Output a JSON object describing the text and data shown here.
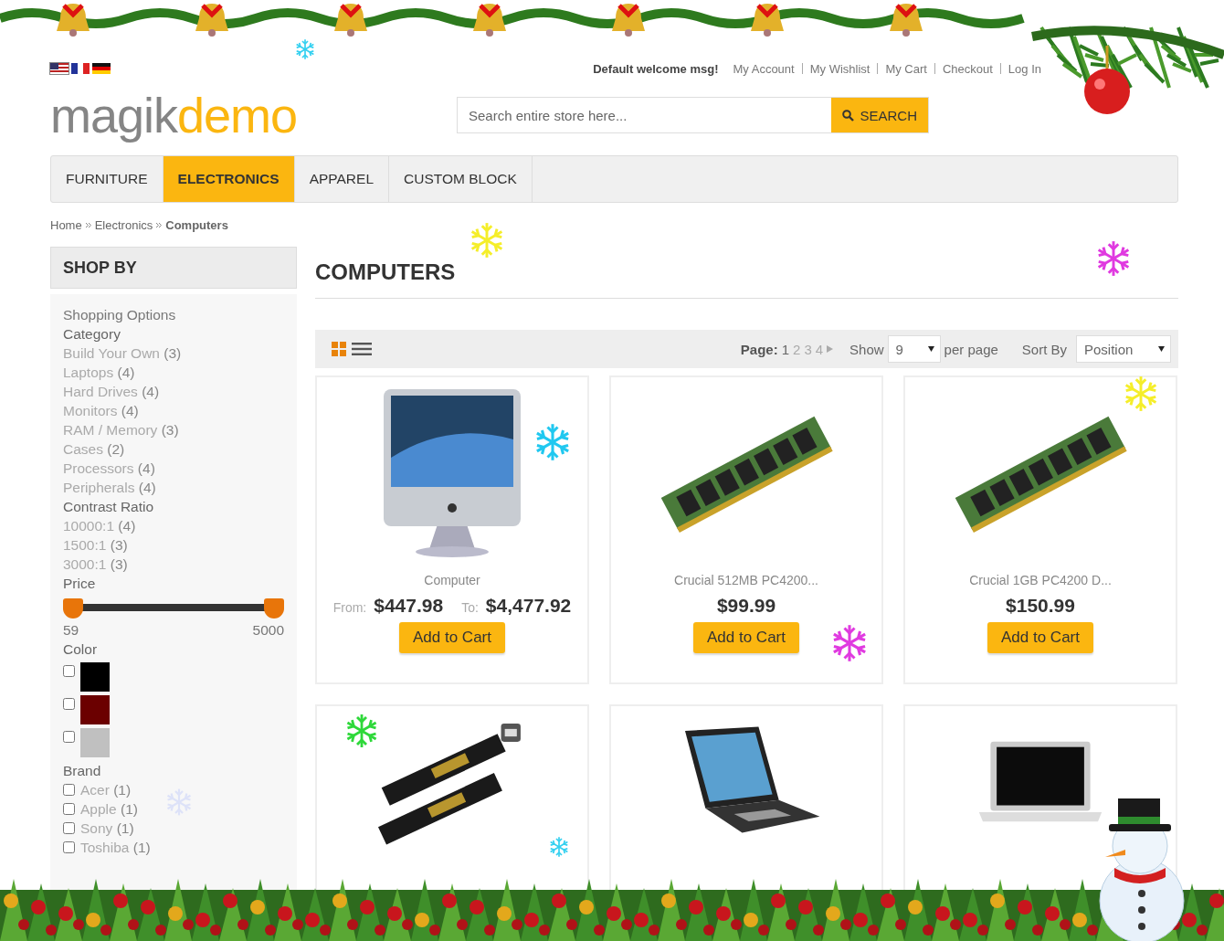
{
  "header": {
    "languages": [
      {
        "kind": "us",
        "selected": true
      },
      {
        "kind": "fr",
        "selected": false
      },
      {
        "kind": "de",
        "selected": false
      }
    ],
    "welcome": "Default welcome msg!",
    "links": [
      "My Account",
      "My Wishlist",
      "My Cart",
      "Checkout",
      "Log In"
    ],
    "logo": {
      "first": "magik",
      "second": "demo"
    },
    "search": {
      "placeholder": "Search entire store here...",
      "button": "SEARCH"
    }
  },
  "nav": [
    {
      "label": "FURNITURE",
      "selected": false
    },
    {
      "label": "ELECTRONICS",
      "selected": true
    },
    {
      "label": "APPAREL",
      "selected": false
    },
    {
      "label": "CUSTOM BLOCK",
      "selected": false
    }
  ],
  "breadcrumb": [
    {
      "label": "Home",
      "current": false
    },
    {
      "label": "Electronics",
      "current": false
    },
    {
      "label": "Computers",
      "current": true
    }
  ],
  "sidebar": {
    "title": "SHOP BY",
    "subtitle": "Shopping Options",
    "groups": [
      {
        "kind": "links",
        "title": "Category",
        "items": [
          {
            "label": "Build Your Own",
            "count": "(3)"
          },
          {
            "label": "Laptops",
            "count": "(4)"
          },
          {
            "label": "Hard Drives",
            "count": "(4)"
          },
          {
            "label": "Monitors",
            "count": "(4)"
          },
          {
            "label": "RAM / Memory",
            "count": "(3)"
          },
          {
            "label": "Cases",
            "count": "(2)"
          },
          {
            "label": "Processors",
            "count": "(4)"
          },
          {
            "label": "Peripherals",
            "count": "(4)"
          }
        ]
      },
      {
        "kind": "links",
        "title": "Contrast Ratio",
        "items": [
          {
            "label": "10000:1",
            "count": "(4)"
          },
          {
            "label": "1500:1",
            "count": "(3)"
          },
          {
            "label": "3000:1",
            "count": "(3)"
          }
        ]
      },
      {
        "kind": "range",
        "title": "Price",
        "min": "59",
        "max": "5000",
        "thumbs": [
          {
            "level": 0
          },
          {
            "level": 1
          }
        ]
      },
      {
        "kind": "swatches",
        "title": "Color",
        "items": [
          {
            "color": "#000000",
            "checked": false
          },
          {
            "color": "#6b0000",
            "checked": false
          },
          {
            "color": "#c0c0c0",
            "checked": false
          }
        ]
      },
      {
        "kind": "checks",
        "title": "Brand",
        "items": [
          {
            "label": "Acer",
            "count": "(1)",
            "checked": false
          },
          {
            "label": "Apple",
            "count": "(1)",
            "checked": false
          },
          {
            "label": "Sony",
            "count": "(1)",
            "checked": false
          },
          {
            "label": "Toshiba",
            "count": "(1)",
            "checked": false
          }
        ]
      }
    ]
  },
  "main": {
    "title": "COMPUTERS",
    "toolbar": {
      "views": [
        {
          "kind": "grid",
          "selected": true
        },
        {
          "kind": "list",
          "selected": false
        }
      ],
      "page_label": "Page:",
      "pages": [
        {
          "label": "1",
          "selected": true
        },
        {
          "label": "2",
          "selected": false
        },
        {
          "label": "3",
          "selected": false
        },
        {
          "label": "4",
          "selected": false
        }
      ],
      "show_label": "Show",
      "show_value": "9",
      "per_page": "per page",
      "sort_label": "Sort By",
      "sort_value": "Position"
    },
    "products": [
      {
        "name": "Computer",
        "kind": "range",
        "from_label": "From:",
        "from": "$447.98",
        "to_label": "To:",
        "to": "$4,477.92",
        "button": "Add to Cart"
      },
      {
        "name": "Crucial 512MB PC4200...",
        "kind": "single",
        "price": "$99.99",
        "button": "Add to Cart"
      },
      {
        "name": "Crucial 1GB PC4200 D...",
        "kind": "single",
        "price": "$150.99",
        "button": "Add to Cart"
      },
      {
        "kind": "image_only"
      },
      {
        "kind": "image_only"
      },
      {
        "kind": "image_only"
      }
    ]
  }
}
